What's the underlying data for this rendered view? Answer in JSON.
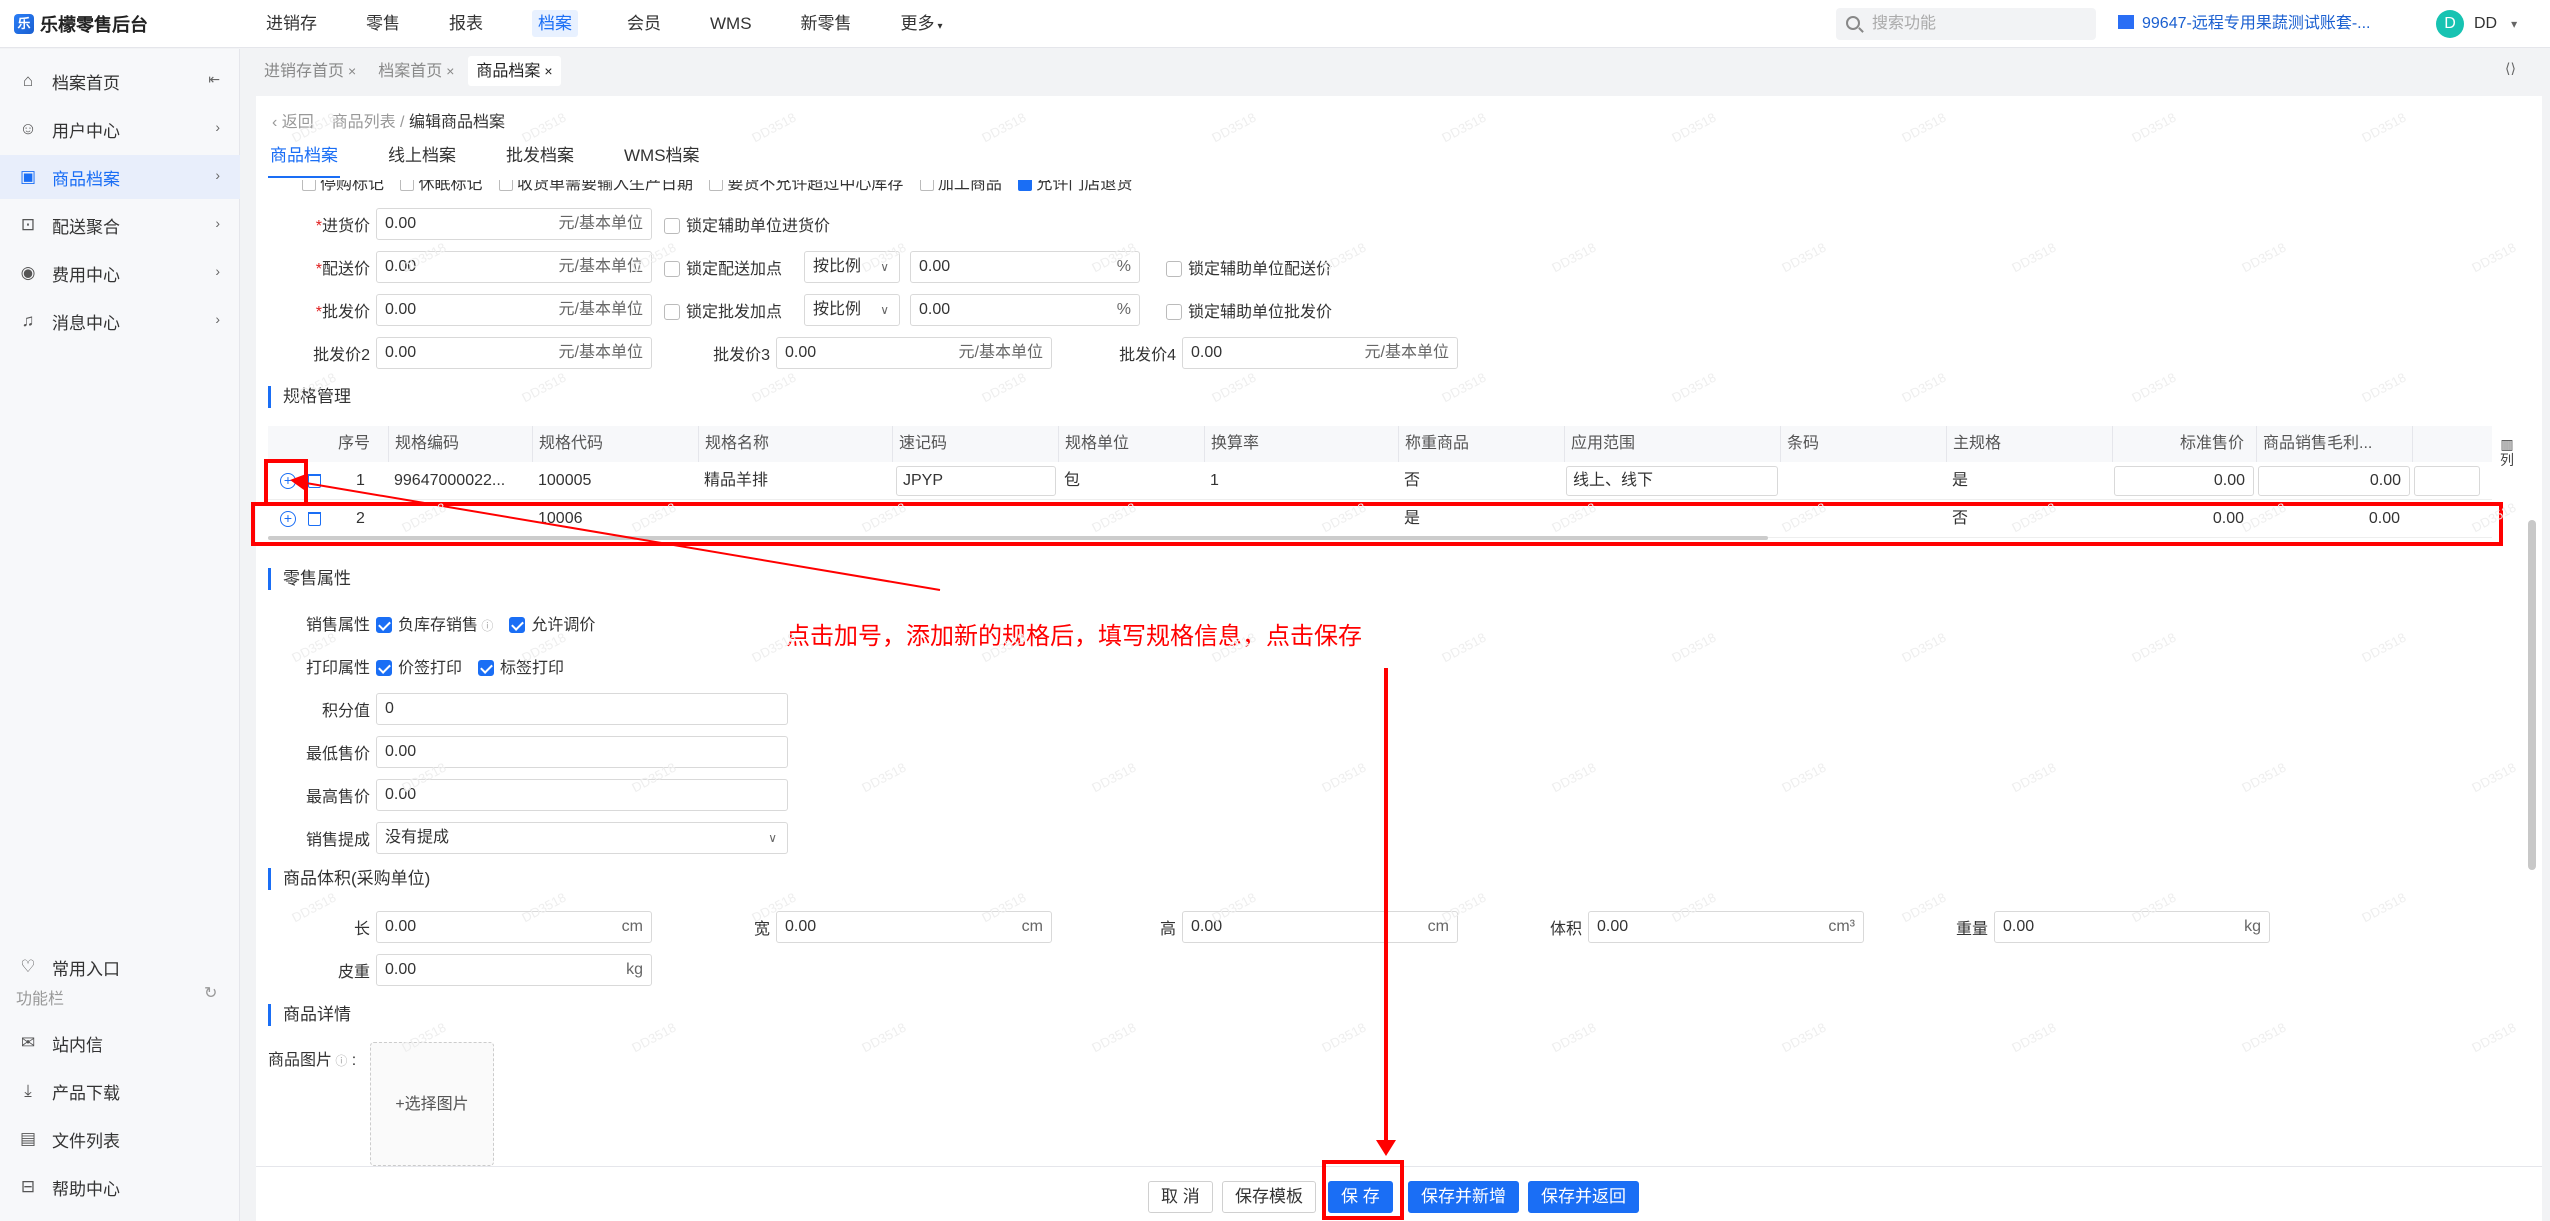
{
  "app": {
    "title": "乐檬零售后台",
    "logo_char": "乐"
  },
  "topnav": [
    {
      "label": "进销存"
    },
    {
      "label": "零售"
    },
    {
      "label": "报表"
    },
    {
      "label": "档案"
    },
    {
      "label": "会员"
    },
    {
      "label": "WMS"
    },
    {
      "label": "新零售"
    },
    {
      "label": "更多"
    }
  ],
  "topnav_active": "档案",
  "search": {
    "placeholder": "搜索功能"
  },
  "account": {
    "label": "99647-远程专用果蔬测试账套-..."
  },
  "user": {
    "avatar": "D",
    "name": "DD"
  },
  "sidebar": {
    "items": [
      {
        "label": "档案首页"
      },
      {
        "label": "用户中心"
      },
      {
        "label": "商品档案"
      },
      {
        "label": "配送聚合"
      },
      {
        "label": "费用中心"
      },
      {
        "label": "消息中心"
      }
    ],
    "bottom": {
      "favorite": "常用入口",
      "section": "功能栏",
      "items": [
        {
          "label": "站内信"
        },
        {
          "label": "产品下载"
        },
        {
          "label": "文件列表"
        },
        {
          "label": "帮助中心"
        }
      ]
    }
  },
  "tabs": [
    {
      "label": "进销存首页"
    },
    {
      "label": "档案首页"
    },
    {
      "label": "商品档案"
    }
  ],
  "breadcrumb": {
    "back": "返回",
    "parent": "商品列表",
    "sep": "/",
    "current": "编辑商品档案"
  },
  "subtabs": [
    {
      "label": "商品档案"
    },
    {
      "label": "线上档案"
    },
    {
      "label": "批发档案"
    },
    {
      "label": "WMS档案"
    }
  ],
  "cut_row": [
    "停购标记",
    "休眠标记",
    "收货单需要输入生产日期",
    "要货不允许超过中心库存",
    "加工商品",
    "允许门店退货"
  ],
  "prices": {
    "purchase": {
      "label": "进货价",
      "value": "0.00",
      "unit": "元/基本单位",
      "lock": "锁定辅助单位进货价"
    },
    "delivery": {
      "label": "配送价",
      "value": "0.00",
      "unit": "元/基本单位",
      "lock_add": "锁定配送加点",
      "mode": "按比例",
      "pct": "0.00",
      "pct_unit": "%",
      "lock_aux": "锁定辅助单位配送价"
    },
    "wholesale": {
      "label": "批发价",
      "value": "0.00",
      "unit": "元/基本单位",
      "lock_add": "锁定批发加点",
      "mode": "按比例",
      "pct": "0.00",
      "pct_unit": "%",
      "lock_aux": "锁定辅助单位批发价"
    },
    "w2": {
      "label": "批发价2",
      "value": "0.00",
      "unit": "元/基本单位"
    },
    "w3": {
      "label": "批发价3",
      "value": "0.00",
      "unit": "元/基本单位"
    },
    "w4": {
      "label": "批发价4",
      "value": "0.00",
      "unit": "元/基本单位"
    }
  },
  "spec": {
    "title": "规格管理",
    "columns": [
      "序号",
      "规格编码",
      "规格代码",
      "规格名称",
      "速记码",
      "规格单位",
      "换算率",
      "称重商品",
      "应用范围",
      "条码",
      "主规格",
      "标准售价",
      "商品销售毛利..."
    ],
    "rows": [
      {
        "no": "1",
        "code": "99647000022...",
        "spec_code": "100005",
        "name": "精品羊排",
        "mnemonic": "JPYP",
        "unit": "包",
        "ratio": "1",
        "weigh": "否",
        "scope": "线上、线下",
        "barcode": "",
        "main": "是",
        "price": "0.00",
        "margin": "0.00"
      },
      {
        "no": "2",
        "code": "",
        "spec_code": "10006",
        "name": "",
        "mnemonic": "",
        "unit": "",
        "ratio": "",
        "weigh": "是",
        "scope": "",
        "barcode": "",
        "main": "否",
        "price": "0.00",
        "margin": "0.00"
      }
    ],
    "col_setting": "列"
  },
  "retail": {
    "title": "零售属性",
    "sale_label": "销售属性",
    "sale_opts": [
      "负库存销售",
      "允许调价"
    ],
    "print_label": "打印属性",
    "print_opts": [
      "价签打印",
      "标签打印"
    ],
    "points": {
      "label": "积分值",
      "value": "0"
    },
    "min_price": {
      "label": "最低售价",
      "value": "0.00"
    },
    "max_price": {
      "label": "最高售价",
      "value": "0.00"
    },
    "commission": {
      "label": "销售提成",
      "value": "没有提成"
    }
  },
  "volume": {
    "title": "商品体积(采购单位)",
    "fields": [
      {
        "label": "长",
        "value": "0.00",
        "unit": "cm"
      },
      {
        "label": "宽",
        "value": "0.00",
        "unit": "cm"
      },
      {
        "label": "高",
        "value": "0.00",
        "unit": "cm"
      },
      {
        "label": "体积",
        "value": "0.00",
        "unit": "cm³"
      },
      {
        "label": "重量",
        "value": "0.00",
        "unit": "kg"
      }
    ],
    "tare": {
      "label": "皮重",
      "value": "0.00",
      "unit": "kg"
    }
  },
  "detail": {
    "title": "商品详情",
    "img_label": "商品图片",
    "img_btn": "+选择图片"
  },
  "footer": {
    "cancel": "取 消",
    "save_template": "保存模板",
    "save": "保 存",
    "save_new": "保存并新增",
    "save_return": "保存并返回"
  },
  "annotation": "点击加号，添加新的规格后，填写规格信息，点击保存",
  "watermark": "DD3518",
  "colors": {
    "accent": "#1a6ef5",
    "annotation": "#ff0000"
  }
}
